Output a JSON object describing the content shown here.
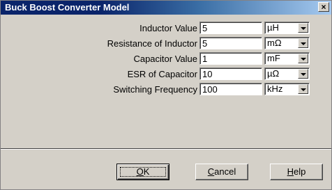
{
  "window": {
    "title": "Buck Boost Converter Model",
    "close_label": "×"
  },
  "fields": [
    {
      "label": "Inductor Value",
      "value": "5",
      "unit": "µH"
    },
    {
      "label": "Resistance of Inductor",
      "value": "5",
      "unit": "mΩ"
    },
    {
      "label": "Capacitor Value",
      "value": "1",
      "unit": "mF"
    },
    {
      "label": "ESR of Capacitor",
      "value": "10",
      "unit": "µΩ"
    },
    {
      "label": "Switching Frequency",
      "value": "100",
      "unit": "kHz"
    }
  ],
  "buttons": {
    "ok": {
      "mnemonic": "O",
      "rest": "K"
    },
    "cancel": {
      "mnemonic": "C",
      "rest": "ancel"
    },
    "help": {
      "mnemonic": "H",
      "rest": "elp"
    }
  }
}
